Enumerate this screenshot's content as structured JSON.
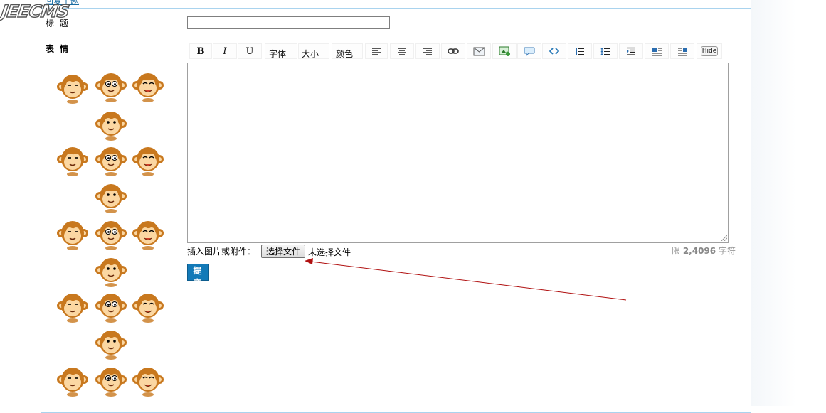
{
  "header": {
    "logo": "JEECMS",
    "topic_link": "回复主题"
  },
  "form": {
    "title_label": "标  题",
    "emoticon_label": "表  情",
    "title_value": "",
    "attach_label": "插入图片或附件：",
    "file_button": "选择文件",
    "file_status": "未选择文件",
    "limit_prefix": "限 ",
    "limit_value": "2,4096",
    "limit_suffix": " 字符",
    "submit_label": "提 交",
    "editor_value": ""
  },
  "toolbar": {
    "bold": "B",
    "italic": "I",
    "underline": "U",
    "font": "字体",
    "size": "大小",
    "color": "颜色",
    "hide": "Hide"
  },
  "emoticons": [
    "crying-monkey",
    "hi-monkey",
    "kiss-monkey",
    "shocked-monkey",
    "love-monkey",
    "shy-monkey",
    "mask-monkey",
    "grin-monkey",
    "flower-monkey",
    "pout-monkey",
    "phone-monkey",
    "scooter-monkey",
    "sweat-monkey",
    "blush-monkey",
    "snorkel-monkey",
    "angry-monkey",
    "bow-monkey",
    "hair-monkey",
    "stare-monkey"
  ],
  "colors": {
    "accent": "#137ab8",
    "border": "#a9d3ee",
    "arrow": "#b01010",
    "monkey": "#c8781e",
    "face": "#fbd7a2"
  }
}
